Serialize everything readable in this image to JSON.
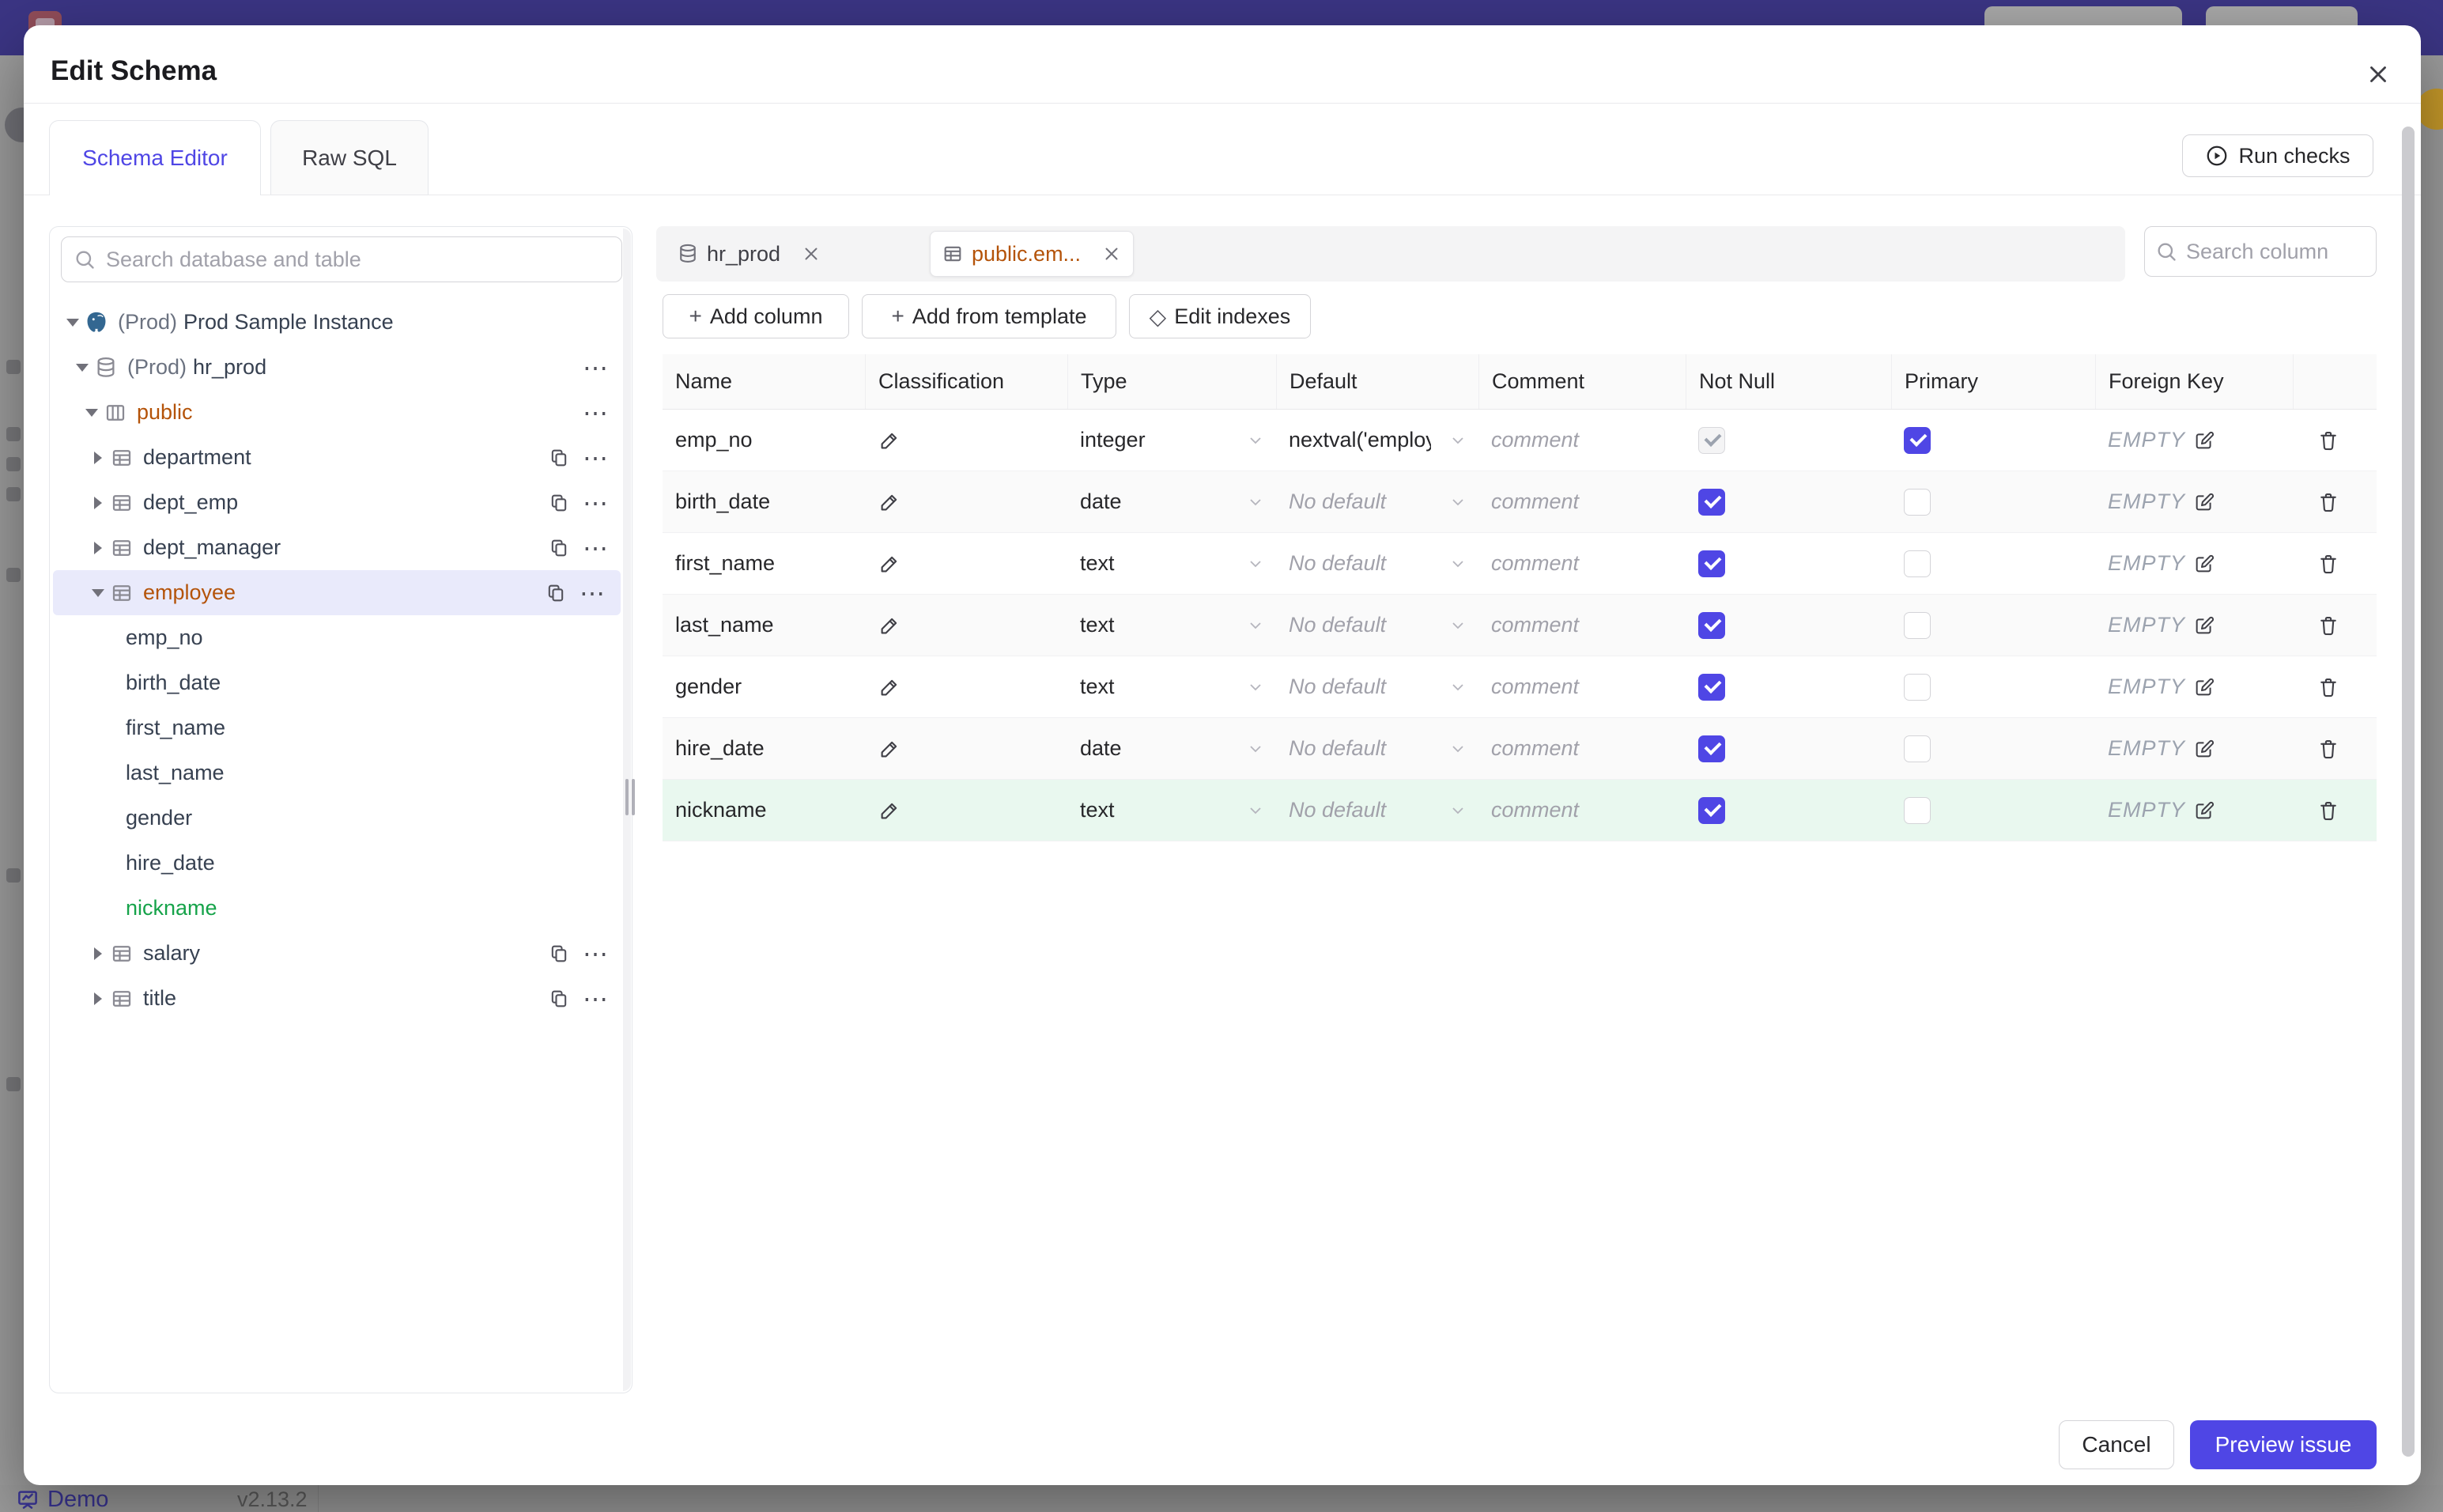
{
  "modal": {
    "title": "Edit Schema"
  },
  "tabs": {
    "schema_editor": "Schema Editor",
    "raw_sql": "Raw SQL"
  },
  "header": {
    "run_checks": "Run checks"
  },
  "sidebar": {
    "search_placeholder": "Search database and table",
    "tree": {
      "instance_env": "(Prod)",
      "instance_name": "Prod Sample Instance",
      "db_env": "(Prod)",
      "db_name": "hr_prod",
      "schema_name": "public",
      "tables": [
        "department",
        "dept_emp",
        "dept_manager"
      ],
      "selected_table": "employee",
      "columns": [
        "emp_no",
        "birth_date",
        "first_name",
        "last_name",
        "gender",
        "hire_date"
      ],
      "added_column": "nickname",
      "tables_after": [
        "salary",
        "title"
      ]
    }
  },
  "editor": {
    "chips": {
      "database": "hr_prod",
      "table": "public.em..."
    },
    "column_search_placeholder": "Search column",
    "toolbar": {
      "add_column": "Add column",
      "add_from_template": "Add from template",
      "edit_indexes": "Edit indexes"
    },
    "grid": {
      "headers": {
        "name": "Name",
        "classification": "Classification",
        "type": "Type",
        "default": "Default",
        "comment": "Comment",
        "not_null": "Not Null",
        "primary": "Primary",
        "foreign_key": "Foreign Key"
      },
      "no_default": "No default",
      "comment_placeholder": "comment",
      "fk_empty": "EMPTY",
      "rows": [
        {
          "name": "emp_no",
          "type": "integer",
          "default": "nextval('employ",
          "not_null": "checked-disabled",
          "primary": true,
          "added": false
        },
        {
          "name": "birth_date",
          "type": "date",
          "default": "No default",
          "not_null": true,
          "primary": false,
          "added": false
        },
        {
          "name": "first_name",
          "type": "text",
          "default": "No default",
          "not_null": true,
          "primary": false,
          "added": false
        },
        {
          "name": "last_name",
          "type": "text",
          "default": "No default",
          "not_null": true,
          "primary": false,
          "added": false
        },
        {
          "name": "gender",
          "type": "text",
          "default": "No default",
          "not_null": true,
          "primary": false,
          "added": false
        },
        {
          "name": "hire_date",
          "type": "date",
          "default": "No default",
          "not_null": true,
          "primary": false,
          "added": false
        },
        {
          "name": "nickname",
          "type": "text",
          "default": "No default",
          "not_null": true,
          "primary": false,
          "added": true
        }
      ]
    }
  },
  "actions": {
    "cancel": "Cancel",
    "preview_issue": "Preview issue"
  },
  "statusbar": {
    "demo": "Demo",
    "version": "v2.13.2"
  },
  "icons": {
    "plus": "+",
    "diamond": "◇",
    "ellipsis": "⋯"
  },
  "colors": {
    "accent": "#4f46e5",
    "modified_text": "#b45309",
    "added_text": "#16a34a",
    "added_row_bg": "#e9f8ef",
    "selected_row_bg": "#e9eafb"
  }
}
